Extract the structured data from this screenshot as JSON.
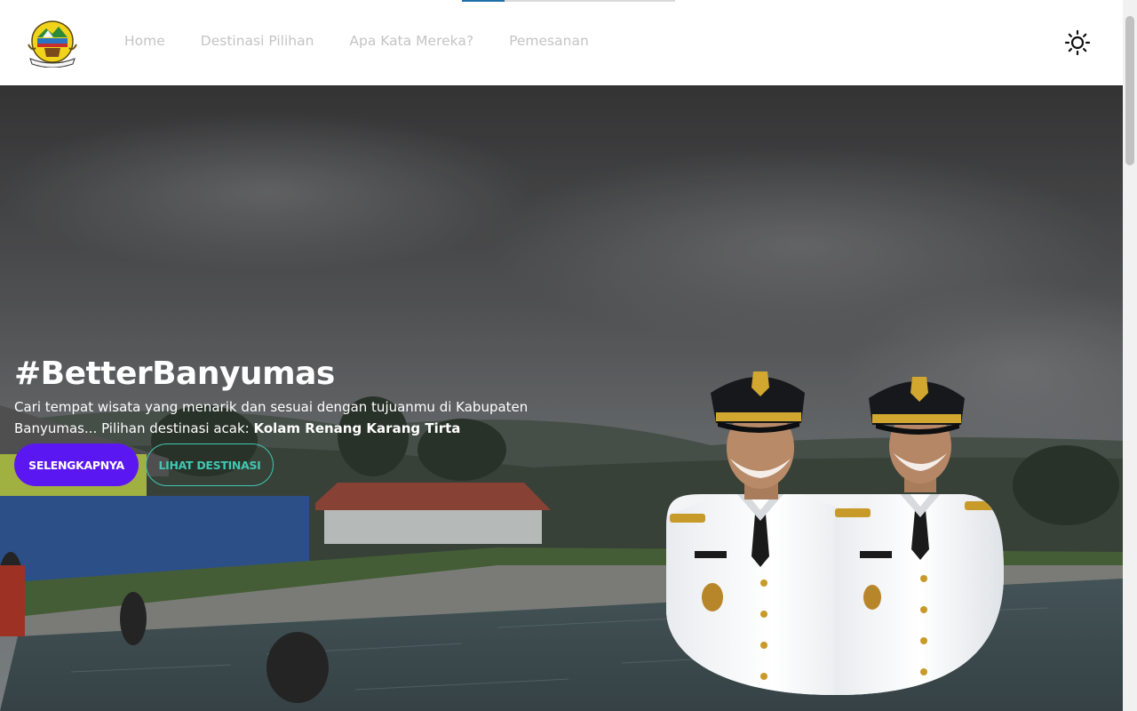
{
  "nav": {
    "items": [
      "Home",
      "Destinasi Pilihan",
      "Apa Kata Mereka?",
      "Pemesanan"
    ]
  },
  "progress": {
    "fraction": 0.2
  },
  "hero": {
    "title": "#BetterBanyumas",
    "description": "Cari tempat wisata yang menarik dan sesuai dengan tujuanmu di Kabupaten Banyumas... Pilihan destinasi acak:",
    "random_destination": "Kolam Renang Karang Tirta",
    "primary_button": "SELENGKAPNYA",
    "secondary_button": "LIHAT DESTINASI"
  },
  "icons": {
    "logo": "banyumas-regency-emblem",
    "theme_toggle": "sun-icon"
  },
  "colors": {
    "primary_button": "#5b17f2",
    "outline_button": "#3fc7b4",
    "nav_text": "#c4c4c4"
  }
}
